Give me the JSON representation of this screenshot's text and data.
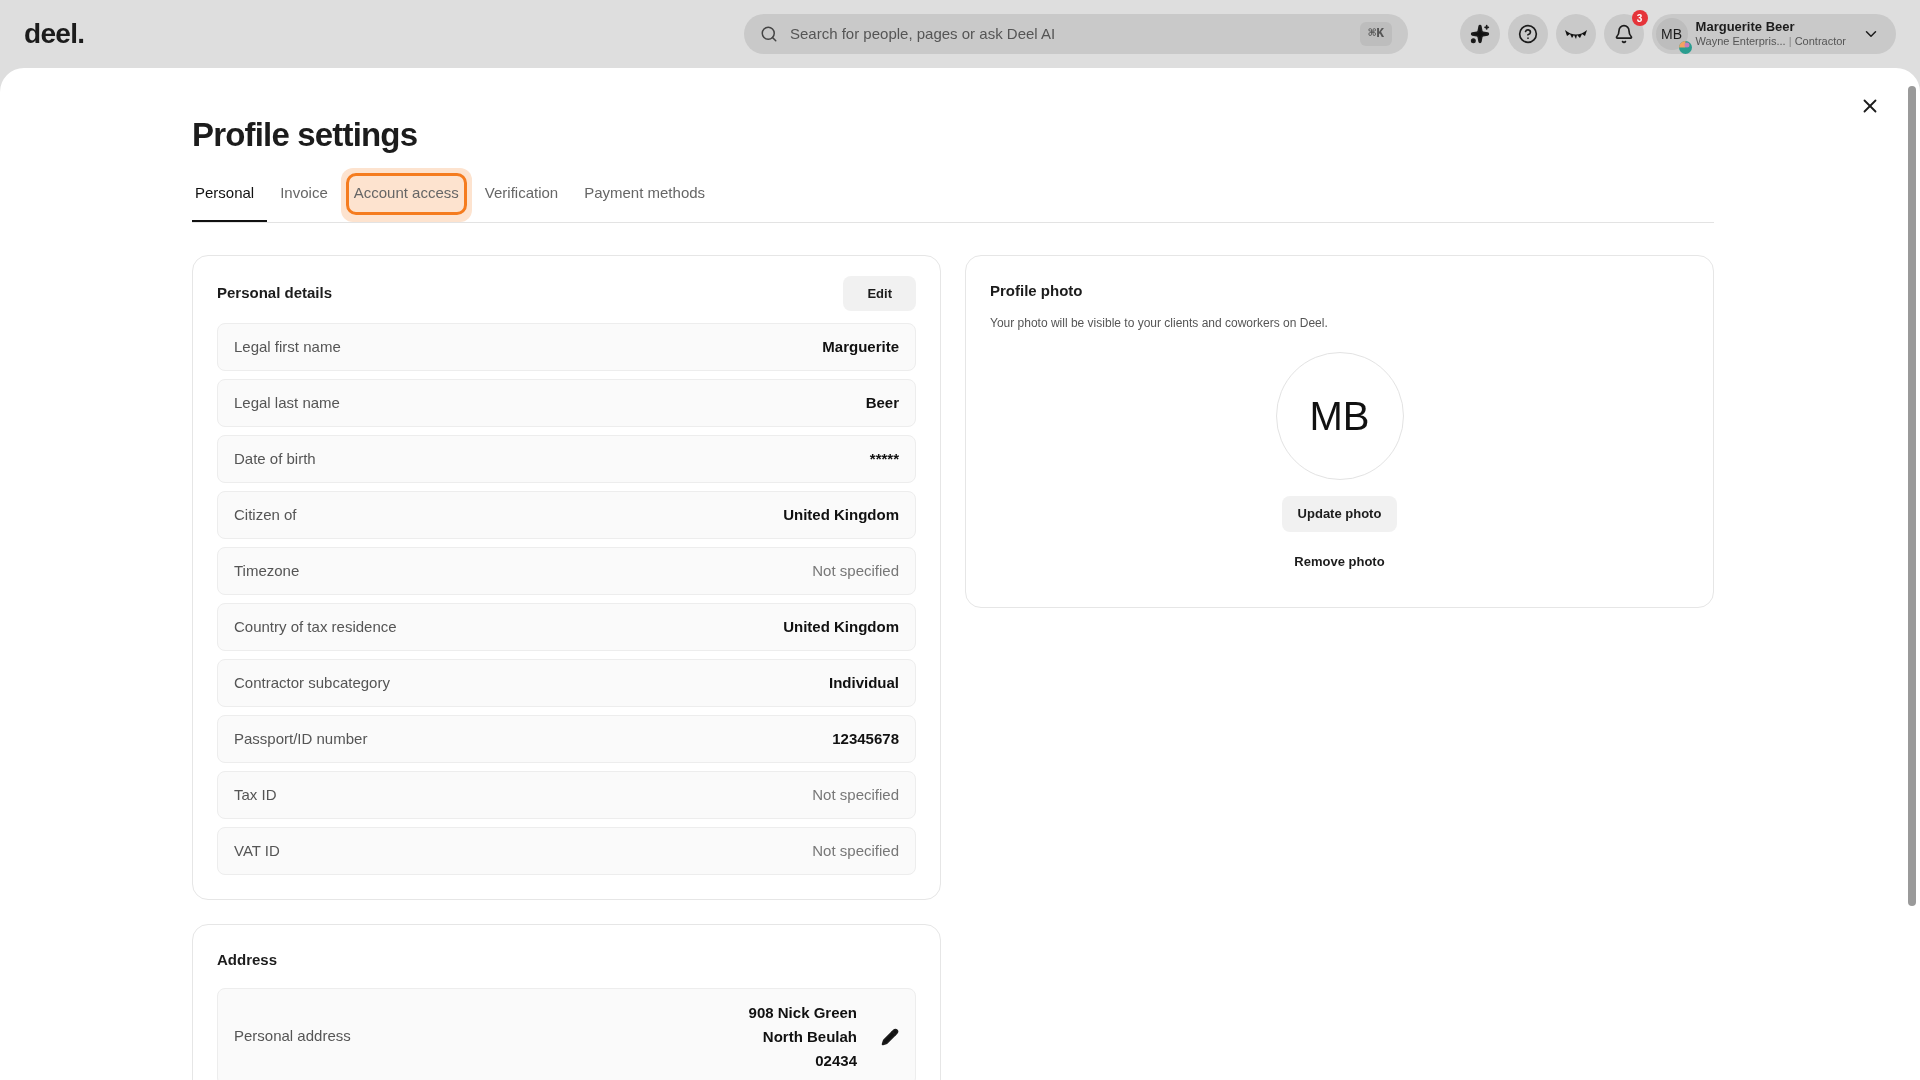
{
  "topbar": {
    "logo": "deel.",
    "search": {
      "placeholder": "Search for people, pages or ask Deel AI",
      "shortcut": "⌘K"
    },
    "notifications": {
      "count": "3"
    },
    "user": {
      "initials": "MB",
      "name": "Marguerite Beer",
      "company": "Wayne Enterpris...",
      "separator": "|",
      "role": "Contractor"
    }
  },
  "page": {
    "title": "Profile settings"
  },
  "tabs": [
    {
      "label": "Personal",
      "selected": true,
      "focused": false
    },
    {
      "label": "Invoice",
      "selected": false,
      "focused": false
    },
    {
      "label": "Account access",
      "selected": false,
      "focused": true
    },
    {
      "label": "Verification",
      "selected": false,
      "focused": false
    },
    {
      "label": "Payment methods",
      "selected": false,
      "focused": false
    }
  ],
  "personal_details": {
    "title": "Personal details",
    "edit_button": "Edit",
    "rows": [
      {
        "label": "Legal first name",
        "value": "Marguerite",
        "empty": false
      },
      {
        "label": "Legal last name",
        "value": "Beer",
        "empty": false
      },
      {
        "label": "Date of birth",
        "value": "*****",
        "empty": false
      },
      {
        "label": "Citizen of",
        "value": "United Kingdom",
        "empty": false
      },
      {
        "label": "Timezone",
        "value": "Not specified",
        "empty": true
      },
      {
        "label": "Country of tax residence",
        "value": "United Kingdom",
        "empty": false
      },
      {
        "label": "Contractor subcategory",
        "value": "Individual",
        "empty": false
      },
      {
        "label": "Passport/ID number",
        "value": "12345678",
        "empty": false
      },
      {
        "label": "Tax ID",
        "value": "Not specified",
        "empty": true
      },
      {
        "label": "VAT ID",
        "value": "Not specified",
        "empty": true
      }
    ]
  },
  "profile_photo": {
    "title": "Profile photo",
    "description": "Your photo will be visible to your clients and coworkers on Deel.",
    "initials": "MB",
    "update_button": "Update photo",
    "remove_button": "Remove photo"
  },
  "address": {
    "title": "Address",
    "rows": [
      {
        "label": "Personal address",
        "lines": [
          "908 Nick Green",
          "North Beulah",
          "02434"
        ]
      }
    ]
  }
}
